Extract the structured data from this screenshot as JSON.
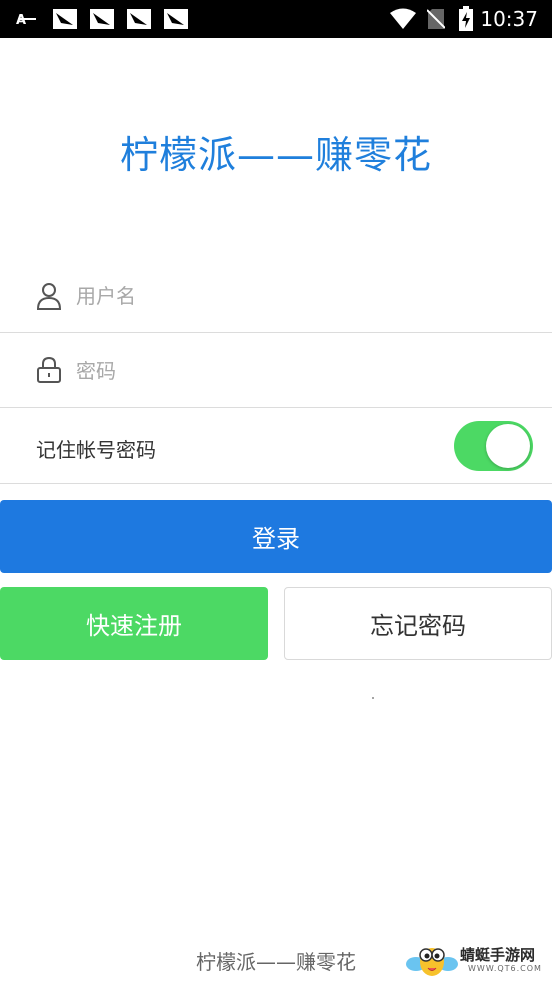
{
  "status_bar": {
    "time": "10:37",
    "left_icons": [
      "font-icon",
      "app-notification-icon",
      "app-notification-icon",
      "app-notification-icon",
      "app-notification-icon"
    ],
    "right_icons": [
      "wifi-icon",
      "no-sim-icon",
      "battery-charging-icon"
    ]
  },
  "app": {
    "title": "柠檬派——赚零花"
  },
  "login_form": {
    "username_placeholder": "用户名",
    "username_value": "",
    "username_icon": "user-icon",
    "password_placeholder": "密码",
    "password_value": "",
    "password_icon": "lock-icon",
    "remember_label": "记住帐号密码",
    "remember_enabled": true
  },
  "buttons": {
    "login": "登录",
    "register": "快速注册",
    "forgot": "忘记密码"
  },
  "footer": {
    "text": "柠檬派——赚零花"
  },
  "watermark": {
    "text": "蜻蜓手游网",
    "sub": "WWW.QT6.COM"
  },
  "colors": {
    "accent_blue": "#1e79e0",
    "title_blue": "#1f7fdc",
    "green": "#4cd964"
  }
}
